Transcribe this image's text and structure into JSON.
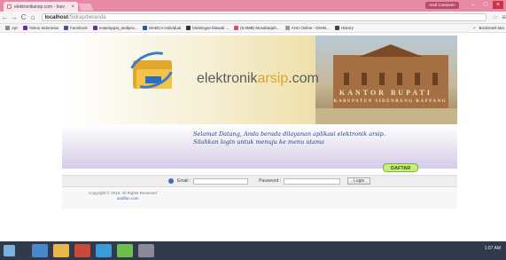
{
  "browser": {
    "tab_title": "elektronikarsip.com - Inov",
    "tab_close": "×",
    "user_pill": "Andi Cureaven",
    "window_buttons": [
      "–",
      "□",
      "×"
    ],
    "nav": {
      "back": "←",
      "forward": "→",
      "reload": "C",
      "home": "⌂"
    },
    "url_host": "localhost",
    "url_path": "/Sidrap/beranda",
    "star": "☆",
    "menu": "≡"
  },
  "bookmarks": {
    "items": [
      {
        "label": "Apl",
        "icon_color": "#8a8a8a"
      },
      {
        "label": "Yahoo Indonesia",
        "icon_color": "#6b2bb0"
      },
      {
        "label": "Facebook",
        "icon_color": "#3b5998"
      },
      {
        "label": "notarisppat_andipra...",
        "icon_color": "#6b2bb0"
      },
      {
        "label": "MABCA Individual",
        "icon_color": "#1c5fa8"
      },
      {
        "label": "bimbingan tilawati ...",
        "icon_color": "#333333"
      },
      {
        "label": "(5.6MB) Musabaqah...",
        "icon_color": "#d84a7a"
      },
      {
        "label": "AHU Online - Direkt...",
        "icon_color": "#999999"
      },
      {
        "label": "History",
        "icon_color": "#444444"
      }
    ],
    "overflow": "»",
    "other": "Bookmark lain"
  },
  "banner": {
    "brand_prefix": "elektronik",
    "brand_accent": "arsip",
    "brand_suffix": ".com",
    "kantor": "KANTOR BUPATI",
    "kabupaten": "KABUPATEN SIDENRENG RAPPANG"
  },
  "welcome": {
    "text": "Selamat Datang, Anda berada dilayanan aplikasi elektronik arsip. Silahkan login untuk menuju ke menu utama",
    "daftar_label": "DAFTAR"
  },
  "login": {
    "email_label": "Email :",
    "email_value": "",
    "password_label": "Password :",
    "password_value": "",
    "login_button": "Login"
  },
  "footer": {
    "copyright": "Copyright © 2015. All Rights Reserved",
    "link": "andifun.com"
  },
  "taskbar": {
    "tray_text": "1:07 AM"
  },
  "colors": {
    "accent": "#e0a02a",
    "welcome_text": "#1f3f8a",
    "daftar_bg": "#c7f07a",
    "chrome": "#e88aa6"
  }
}
